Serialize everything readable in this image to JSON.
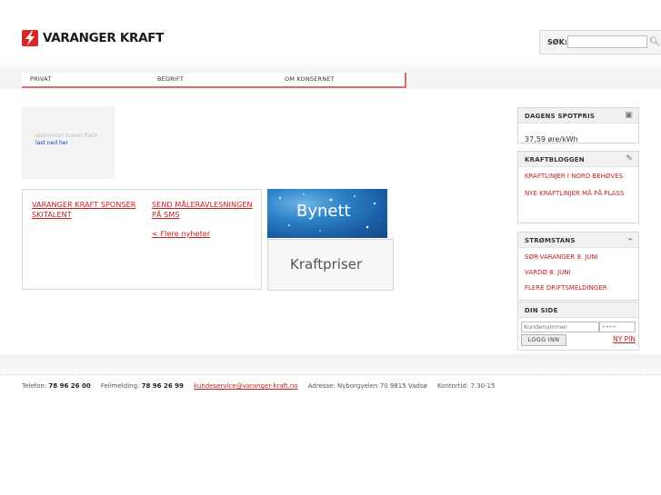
{
  "brand": {
    "name": "VARANGER KRAFT"
  },
  "search": {
    "label": "SØK:",
    "placeholder": ""
  },
  "nav": {
    "tabs": [
      "PRIVAT",
      "BEDRIFT",
      "OM KONSERNET"
    ]
  },
  "flash": {
    "notice": "elementet krever flash",
    "download_link": "last ned her"
  },
  "news": {
    "items": [
      "VARANGER KRAFT SPONSER SKITALENT",
      "SEND MÅLERAVLESNINGEN PÅ SMS"
    ],
    "more_link": "< Flere nyheter"
  },
  "banners": {
    "bynett": "Bynett",
    "kraftpriser": "Kraftpriser"
  },
  "spotpris": {
    "title": "DAGENS SPOTPRIS",
    "value": "37,59 øre/kWh"
  },
  "kraftbloggen": {
    "title": "KRAFTBLOGGEN",
    "items": [
      "KRAFTLINJER I NORD BEHØVES",
      "NYE KRAFTLINJER MÅ PÅ PLASS"
    ]
  },
  "stromstans": {
    "title": "STRØMSTANS",
    "items": [
      "SØR-VARANGER 9. JUNI",
      "VARDØ 8. JUNI",
      "FLERE DRIFTSMELDINGER"
    ]
  },
  "dinside": {
    "title": "DIN SIDE",
    "customer_placeholder": "Kundenummer",
    "pin_value": "••••",
    "login_label": "LOGG INN",
    "newpin_label": "NY PIN"
  },
  "footer": {
    "tel_label": "Telefon:",
    "tel": "78 96 26 00",
    "fault_label": "Feilmelding:",
    "fault": "78 96 26 99",
    "email": "kundeservice@varanger-kraft.no",
    "address": "Adresse: Nyborgveien 70 9815 Vadsø",
    "hours": "Kontortid: 7.30-15"
  },
  "colors": {
    "accent": "#c41e1e",
    "link_blue": "#1b39c7"
  }
}
